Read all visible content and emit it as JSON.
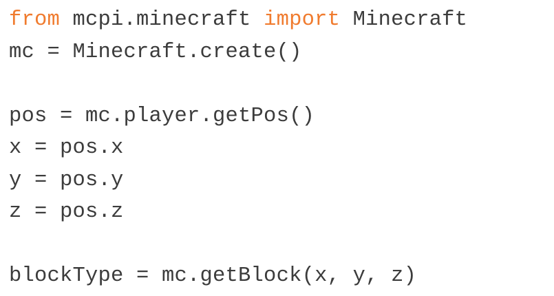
{
  "colors": {
    "keyword": "#f07b2e",
    "text": "#3c3c3c",
    "background": "#ffffff"
  },
  "code": {
    "line1": {
      "kw_from": "from",
      "module": " mcpi.minecraft ",
      "kw_import": "import",
      "name": " Minecraft"
    },
    "line2": "mc = Minecraft.create()",
    "line3": "",
    "line4": "pos = mc.player.getPos()",
    "line5": "x = pos.x",
    "line6": "y = pos.y",
    "line7": "z = pos.z",
    "line8": "",
    "line9": "blockType = mc.getBlock(x, y, z)"
  }
}
